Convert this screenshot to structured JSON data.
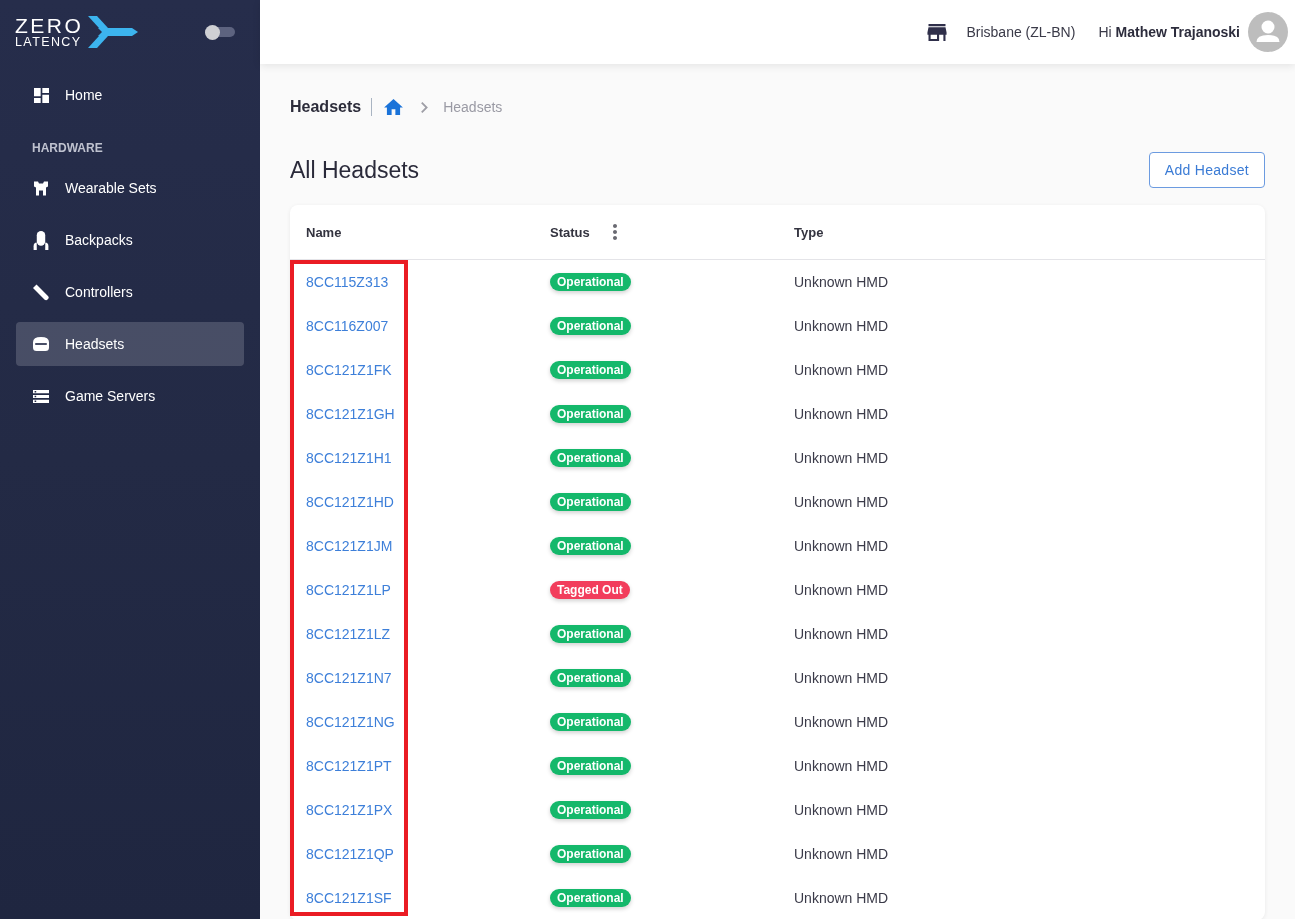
{
  "sidebar": {
    "logo": {
      "line_1": "ZERO",
      "line_2": "LATENCY"
    },
    "theme_toggle": {
      "on": false
    },
    "items": [
      {
        "label": "Home",
        "selected": false
      }
    ],
    "sections": [
      {
        "heading": "HARDWARE",
        "items": [
          {
            "label": "Wearable Sets",
            "selected": false
          },
          {
            "label": "Backpacks",
            "selected": false
          },
          {
            "label": "Controllers",
            "selected": false
          },
          {
            "label": "Headsets",
            "selected": true
          },
          {
            "label": "Game Servers",
            "selected": false
          }
        ]
      }
    ]
  },
  "top_bar": {
    "location": "Brisbane (ZL-BN)",
    "greeting": "Hi **Mathew Trajanoski**"
  },
  "breadcrumb": {
    "page": "Headsets",
    "trail": [
      "Headsets"
    ]
  },
  "page_title": "All Headsets",
  "add_button": "Add Headset",
  "table": {
    "columns": [
      {
        "label": "Name",
        "highlighted": true,
        "menu": false
      },
      {
        "label": "Status",
        "highlighted": false,
        "menu": true
      },
      {
        "label": "Type",
        "highlighted": false,
        "menu": false
      }
    ],
    "rows": [
      {
        "name": "8CC115Z313",
        "status": {
          "label": "Operational",
          "color": "#14b86b"
        },
        "type": "Unknown HMD"
      },
      {
        "name": "8CC116Z007",
        "status": {
          "label": "Operational",
          "color": "#14b86b"
        },
        "type": "Unknown HMD"
      },
      {
        "name": "8CC121Z1FK",
        "status": {
          "label": "Operational",
          "color": "#14b86b"
        },
        "type": "Unknown HMD"
      },
      {
        "name": "8CC121Z1GH",
        "status": {
          "label": "Operational",
          "color": "#14b86b"
        },
        "type": "Unknown HMD"
      },
      {
        "name": "8CC121Z1H1",
        "status": {
          "label": "Operational",
          "color": "#14b86b"
        },
        "type": "Unknown HMD"
      },
      {
        "name": "8CC121Z1HD",
        "status": {
          "label": "Operational",
          "color": "#14b86b"
        },
        "type": "Unknown HMD"
      },
      {
        "name": "8CC121Z1JM",
        "status": {
          "label": "Operational",
          "color": "#14b86b"
        },
        "type": "Unknown HMD"
      },
      {
        "name": "8CC121Z1LP",
        "status": {
          "label": "Tagged Out",
          "color": "#f23d5c"
        },
        "type": "Unknown HMD"
      },
      {
        "name": "8CC121Z1LZ",
        "status": {
          "label": "Operational",
          "color": "#14b86b"
        },
        "type": "Unknown HMD"
      },
      {
        "name": "8CC121Z1N7",
        "status": {
          "label": "Operational",
          "color": "#14b86b"
        },
        "type": "Unknown HMD"
      },
      {
        "name": "8CC121Z1NG",
        "status": {
          "label": "Operational",
          "color": "#14b86b"
        },
        "type": "Unknown HMD"
      },
      {
        "name": "8CC121Z1PT",
        "status": {
          "label": "Operational",
          "color": "#14b86b"
        },
        "type": "Unknown HMD"
      },
      {
        "name": "8CC121Z1PX",
        "status": {
          "label": "Operational",
          "color": "#14b86b"
        },
        "type": "Unknown HMD"
      },
      {
        "name": "8CC121Z1QP",
        "status": {
          "label": "Operational",
          "color": "#14b86b"
        },
        "type": "Unknown HMD"
      },
      {
        "name": "8CC121Z1SF",
        "status": {
          "label": "Operational",
          "color": "#14b86b"
        },
        "type": "Unknown HMD"
      }
    ]
  }
}
